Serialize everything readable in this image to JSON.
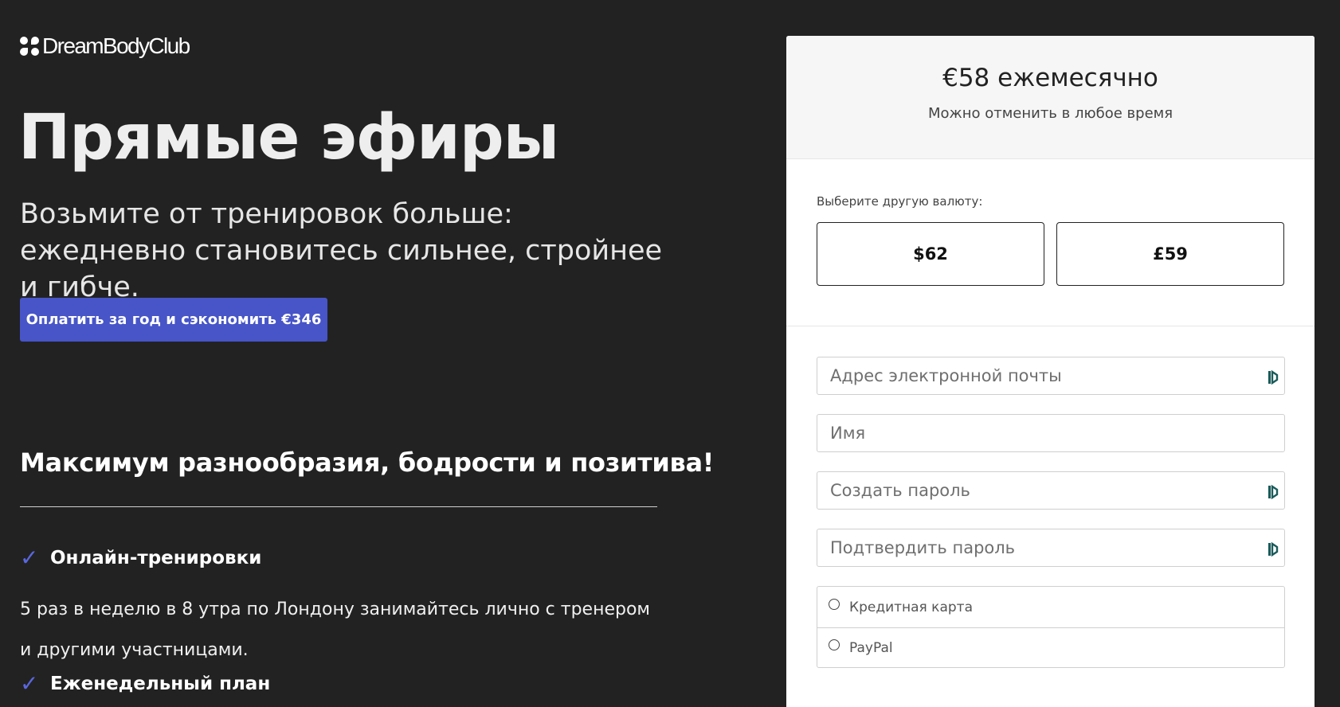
{
  "brand": {
    "name": "DreamBodyClub"
  },
  "hero": {
    "title": "Прямые эфиры",
    "subtitle": "Возьмите от тренировок больше: ежедневно становитесь сильнее, стройнее и гибче.",
    "cta_label": "Оплатить за год и сэкономить €346"
  },
  "benefits": {
    "title": "Максимум разнообразия, бодрости и позитива!",
    "items": [
      {
        "title": "Онлайн-тренировки",
        "description": "5 раз в неделю в 8 утра по Лондону занимайтесь лично с тренером и другими участницами."
      },
      {
        "title": "Еженедельный план"
      }
    ]
  },
  "checkout": {
    "price": "€58 ежемесячно",
    "price_note": "Можно отменить в любое время",
    "currency_label": "Выберите другую валюту:",
    "currencies": [
      "$62",
      "£59"
    ],
    "fields": {
      "email_placeholder": "Адрес электронной почты",
      "name_placeholder": "Имя",
      "password_placeholder": "Создать пароль",
      "confirm_placeholder": "Подтвердить пароль"
    },
    "payment_methods": [
      "Кредитная карта",
      "PayPal"
    ]
  },
  "colors": {
    "background": "#222222",
    "accent": "#4755c8",
    "check": "#5a67e0",
    "panel": "#ffffff",
    "password_icon": "#1a5a5a"
  },
  "icons": {
    "logo": "dreambody-logo-icon",
    "check": "check-icon",
    "password_manager": "password-manager-icon",
    "radio": "radio-icon"
  }
}
